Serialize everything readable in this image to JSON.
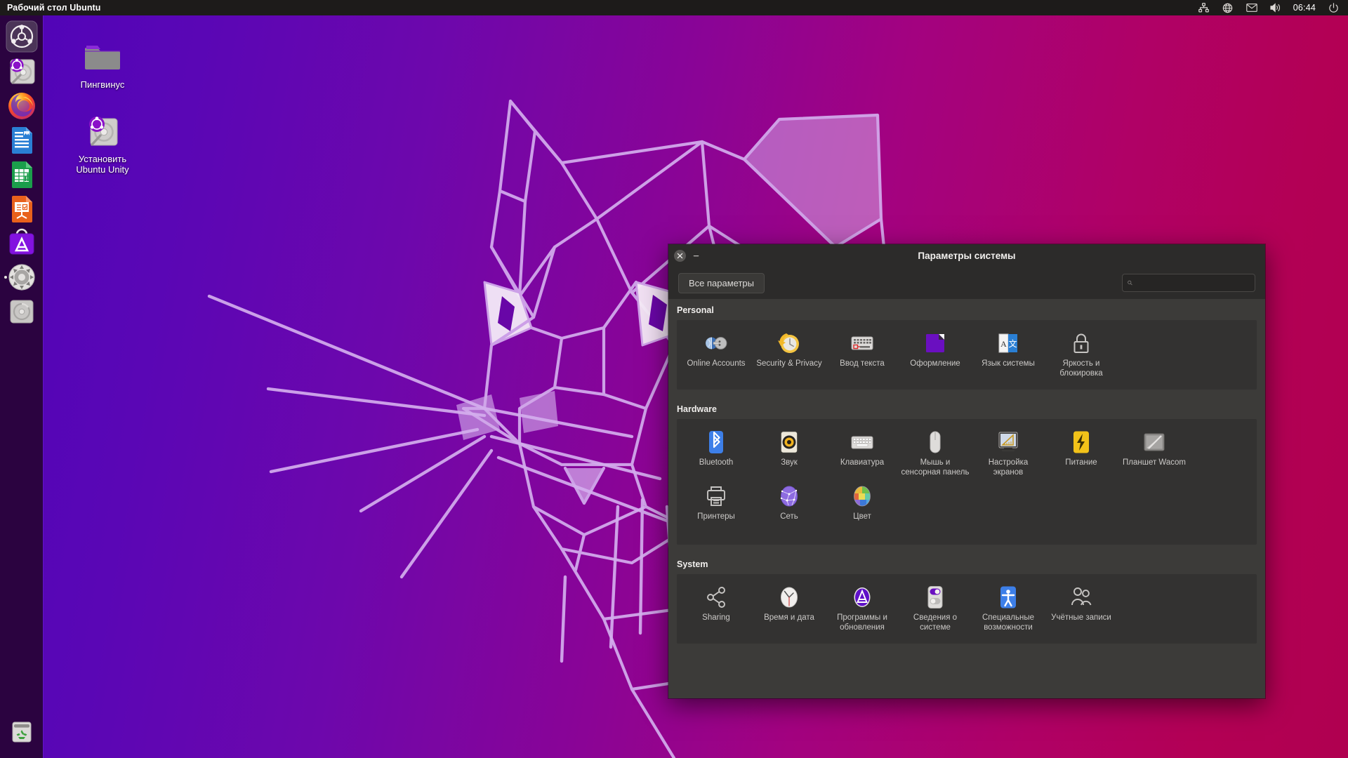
{
  "panel": {
    "title": "Рабочий стол Ubuntu",
    "clock": "06:44",
    "tray": [
      {
        "name": "network-icon",
        "title": "Сеть"
      },
      {
        "name": "globe-icon",
        "title": "Язык"
      },
      {
        "name": "envelope-icon",
        "title": "Сообщения"
      },
      {
        "name": "volume-icon",
        "title": "Звук"
      },
      {
        "name": "power-icon",
        "title": "Система"
      }
    ]
  },
  "launcher": {
    "items": [
      {
        "name": "ubuntu-dash-icon",
        "label": "Ubuntu Dash",
        "running": false
      },
      {
        "name": "install-disk-icon",
        "label": "Установить Ubuntu Unity",
        "running": false
      },
      {
        "name": "firefox-icon",
        "label": "Firefox",
        "running": false
      },
      {
        "name": "libreoffice-writer-icon",
        "label": "LibreOffice Writer",
        "running": false
      },
      {
        "name": "libreoffice-calc-icon",
        "label": "LibreOffice Calc",
        "running": false
      },
      {
        "name": "libreoffice-impress-icon",
        "label": "LibreOffice Impress",
        "running": false
      },
      {
        "name": "ubuntu-software-icon",
        "label": "Ubuntu Software",
        "running": false
      },
      {
        "name": "system-settings-icon",
        "label": "Параметры системы",
        "running": true
      },
      {
        "name": "disc-icon",
        "label": "Диски",
        "running": false
      }
    ],
    "trash": {
      "name": "trash-icon",
      "label": "Корзина"
    }
  },
  "desktop_icons": [
    {
      "name": "folder-icon",
      "label": "Пингвинус"
    },
    {
      "name": "install-disk-icon",
      "label": "Установить Ubuntu Unity"
    }
  ],
  "window": {
    "title": "Параметры системы",
    "close_label": "✕",
    "minimize_label": "–",
    "all_settings_label": "Все параметры",
    "search_placeholder": "",
    "search_value": ""
  },
  "sections": [
    {
      "title": "Personal",
      "items": [
        {
          "icon": "online-accounts-icon",
          "label": "Online Accounts"
        },
        {
          "icon": "security-privacy-icon",
          "label": "Security & Privacy"
        },
        {
          "icon": "text-entry-icon",
          "label": "Ввод текста"
        },
        {
          "icon": "appearance-icon",
          "label": "Оформление"
        },
        {
          "icon": "language-icon",
          "label": "Язык системы"
        },
        {
          "icon": "brightness-lock-icon",
          "label": "Яркость и блокировка"
        }
      ]
    },
    {
      "title": "Hardware",
      "items": [
        {
          "icon": "bluetooth-icon",
          "label": "Bluetooth"
        },
        {
          "icon": "sound-icon",
          "label": "Звук"
        },
        {
          "icon": "keyboard-icon",
          "label": "Клавиатура"
        },
        {
          "icon": "mouse-icon",
          "label": "Мышь и сенсорная панель"
        },
        {
          "icon": "displays-icon",
          "label": "Настройка экранов"
        },
        {
          "icon": "power-bolt-icon",
          "label": "Питание"
        },
        {
          "icon": "wacom-icon",
          "label": "Планшет Wacom"
        },
        {
          "icon": "printers-icon",
          "label": "Принтеры"
        },
        {
          "icon": "network-globe-icon",
          "label": "Сеть"
        },
        {
          "icon": "color-icon",
          "label": "Цвет"
        }
      ]
    },
    {
      "title": "System",
      "items": [
        {
          "icon": "sharing-icon",
          "label": "Sharing"
        },
        {
          "icon": "clock-icon",
          "label": "Время и дата"
        },
        {
          "icon": "software-updates-icon",
          "label": "Программы и обновления"
        },
        {
          "icon": "system-info-icon",
          "label": "Сведения о системе"
        },
        {
          "icon": "accessibility-icon",
          "label": "Специальные возможности"
        },
        {
          "icon": "user-accounts-icon",
          "label": "Учётные записи"
        }
      ]
    }
  ],
  "colors": {
    "panel_bg": "#1D1B1A",
    "launcher_bg": "#2B0340",
    "launcher_edge": "#6414C8",
    "window_bg": "#3C3B39",
    "section_bg": "#333231",
    "titlebar_bg": "#2C2B2A",
    "wallpaper_left": "#4F04B8",
    "wallpaper_right": "#B00050",
    "wallpaper_line": "#D9B6F0",
    "text_primary": "#f2f0ee",
    "text_secondary": "#cbc9c7"
  }
}
